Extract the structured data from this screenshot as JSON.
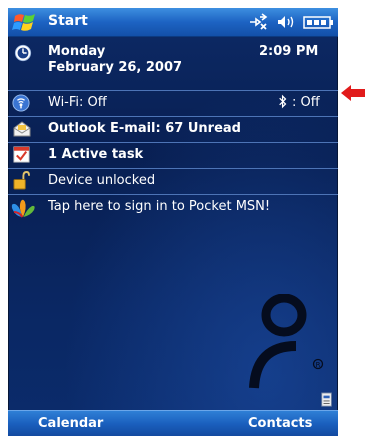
{
  "topbar": {
    "start_label": "Start",
    "icons": [
      "connectivity-icon",
      "speaker-icon",
      "battery-icon"
    ]
  },
  "today": {
    "date_day": "Monday",
    "date_full": "February 26, 2007",
    "time": "2:09 PM",
    "wifi_label": "Wi-Fi: Off",
    "bluetooth_label": ": Off",
    "email_label": "Outlook E-mail: 67 Unread",
    "tasks_label": "1 Active task",
    "lock_label": "Device unlocked",
    "msn_label": "Tap here to sign in to Pocket MSN!"
  },
  "softkeys": {
    "left": "Calendar",
    "right": "Contacts"
  },
  "colors": {
    "background": "#0a2763",
    "bar": "#1d63c3",
    "arrow": "#e11b1b"
  }
}
